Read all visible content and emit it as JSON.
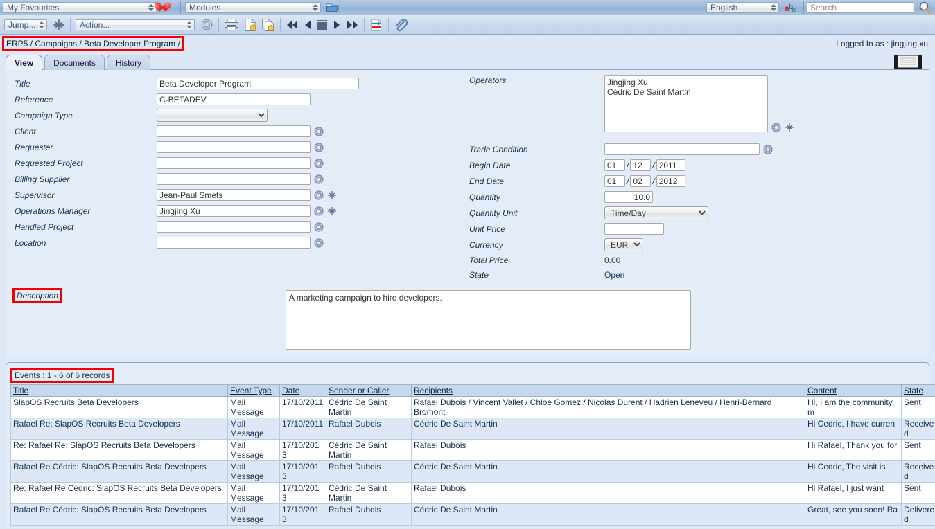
{
  "topbar": {
    "favourites_label": "My Favourites",
    "favourites_icon": "heart-icon",
    "modules_label": "Modules",
    "modules_icon": "open-folder-icon",
    "language_label": "English",
    "translate_icon": "translate-icon",
    "search_placeholder": "Search",
    "search_value": "",
    "search_icon": "magnifier-icon"
  },
  "actionbar": {
    "jump_label": "Jump...",
    "jump_goto_icon": "goto-icon",
    "action_label": "Action...",
    "workflow_icon": "workflow-gear-icon",
    "print_icon": "print-icon",
    "export_icon": "export-document-icon",
    "copy_icon": "copy-document-icon",
    "first_icon": "first-page-icon",
    "previous_icon": "previous-page-icon",
    "list_icon": "list-view-icon",
    "next_icon": "next-page-icon",
    "last_icon": "last-page-icon",
    "exchange_icon": "exchange-icon",
    "attach_icon": "paperclip-icon"
  },
  "header": {
    "breadcrumb": "ERP5 / Campaigns / Beta Developer Program /",
    "logged_in": "Logged In as : jingjing.xu",
    "save_icon": "floppy-save-icon"
  },
  "tabs": [
    {
      "label": "View",
      "active": true
    },
    {
      "label": "Documents",
      "active": false
    },
    {
      "label": "History",
      "active": false
    }
  ],
  "form": {
    "left": {
      "title_label": "Title",
      "title_value": "Beta Developer Program",
      "reference_label": "Reference",
      "reference_value": "C-BETADEV",
      "campaign_type_label": "Campaign Type",
      "campaign_type_value": "",
      "client_label": "Client",
      "client_value": "",
      "requester_label": "Requester",
      "requester_value": "",
      "requested_project_label": "Requested Project",
      "requested_project_value": "",
      "billing_supplier_label": "Billing Supplier",
      "billing_supplier_value": "",
      "supervisor_label": "Supervisor",
      "supervisor_value": "Jean-Paul Smets",
      "operations_manager_label": "Operations Manager",
      "operations_manager_value": "Jingjing Xu",
      "handled_project_label": "Handled Project",
      "handled_project_value": "",
      "location_label": "Location",
      "location_value": ""
    },
    "right": {
      "operators_label": "Operators",
      "operators_value": "Jingjing Xu\nCédric De Saint Martin",
      "trade_condition_label": "Trade Condition",
      "trade_condition_value": "",
      "begin_date_label": "Begin Date",
      "begin_date_day": "01",
      "begin_date_month": "12",
      "begin_date_year": "2011",
      "end_date_label": "End Date",
      "end_date_day": "01",
      "end_date_month": "02",
      "end_date_year": "2012",
      "quantity_label": "Quantity",
      "quantity_value": "10.0",
      "quantity_unit_label": "Quantity Unit",
      "quantity_unit_value": "Time/Day",
      "unit_price_label": "Unit Price",
      "unit_price_value": "",
      "currency_label": "Currency",
      "currency_value": "EUR",
      "total_price_label": "Total Price",
      "total_price_value": "0.00",
      "state_label": "State",
      "state_value": "Open"
    },
    "description_label": "Description",
    "description_value": "A marketing campaign to hire developers."
  },
  "listbox": {
    "title": "Events : 1 - 6 of 6 records",
    "columns": [
      "Title",
      "Event Type",
      "Date",
      "Sender or Caller",
      "Recipients",
      "Content",
      "State"
    ],
    "rows": [
      {
        "title": "SlapOS Recruits Beta Developers",
        "event_type": "Mail Message",
        "date": "17/10/2011",
        "sender": "Cédric De Saint Martin",
        "recipients": "Rafael Dubois / Vincent Vallet / Chloé Gomez / Nicolas Durent / Hadrien Leneveu / Henri-Bernard Bromont",
        "content": "Hi, I am the community m",
        "state": "Sent"
      },
      {
        "title": "Rafael Re: SlapOS Recruits Beta Developers",
        "event_type": "Mail Message",
        "date": "17/10/2011",
        "sender": "Rafael Dubois",
        "recipients": "Cédric De Saint Martin",
        "content": "Hi Cedric, I have curren",
        "state": "Received"
      },
      {
        "title": "Re: Rafael Re: SlapOS Recruits Beta Developers",
        "event_type": "Mail Message",
        "date": "17/10/2013",
        "sender": "Cédric De Saint Martin",
        "recipients": "Rafael Dubois",
        "content": "Hi Rafael, Thank you for",
        "state": "Sent"
      },
      {
        "title": "Rafael Re Cédric: SlapOS Recruits Beta Developers",
        "event_type": "Mail Message",
        "date": "17/10/2013",
        "sender": "Rafael Dubois",
        "recipients": "Cédric De Saint Martin",
        "content": "Hi Cedric, The visit is",
        "state": "Received"
      },
      {
        "title": "Re: Rafael Re Cédric: SlapOS Recruits Beta Developers",
        "event_type": "Mail Message",
        "date": "17/10/2013",
        "sender": "Cédric De Saint Martin",
        "recipients": "Rafael Dubois",
        "content": "Hi Rafael, I just want",
        "state": "Sent"
      },
      {
        "title": "Rafael Re Cédric: SlapOS Recruits Beta Developers",
        "event_type": "Mail Message",
        "date": "17/10/2013",
        "sender": "Rafael Dubois",
        "recipients": "Cédric De Saint Martin",
        "content": "Great, see you soon! Ra",
        "state": "Delivered"
      }
    ]
  },
  "colors": {
    "highlight": "#f40000",
    "topbar": "#9ebada",
    "panel": "#e4ecf8",
    "header_row": "#c5d8ec",
    "row_alt": "#dde7f5"
  }
}
